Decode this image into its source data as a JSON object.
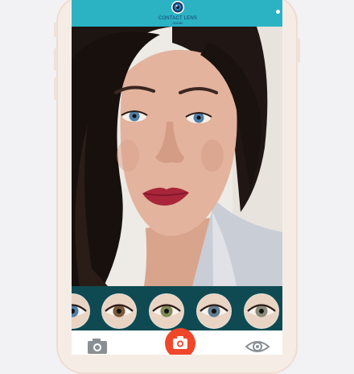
{
  "app": {
    "logo_title": "CONTACT LENS",
    "logo_subtitle": "ONLINE",
    "logo_icon": "eye-logo-icon"
  },
  "colors": {
    "header": "#2bb3c4",
    "lens_strip": "#0f4a52",
    "shutter": "#f0462a",
    "toolbar": "#ffffff"
  },
  "preview": {
    "subject": "camera-preview-face"
  },
  "lenses": [
    {
      "name": "lens-blue",
      "iris": "#4f7fa6"
    },
    {
      "name": "lens-hazel",
      "iris": "#7a5a3a"
    },
    {
      "name": "lens-green",
      "iris": "#7f8a55"
    },
    {
      "name": "lens-grey-blue",
      "iris": "#5f7d92"
    },
    {
      "name": "lens-light",
      "iris": "#8a8a7a"
    }
  ],
  "toolbar": {
    "left_icon": "gallery-camera-icon",
    "center_icon": "camera-icon",
    "right_icon": "eye-icon"
  }
}
